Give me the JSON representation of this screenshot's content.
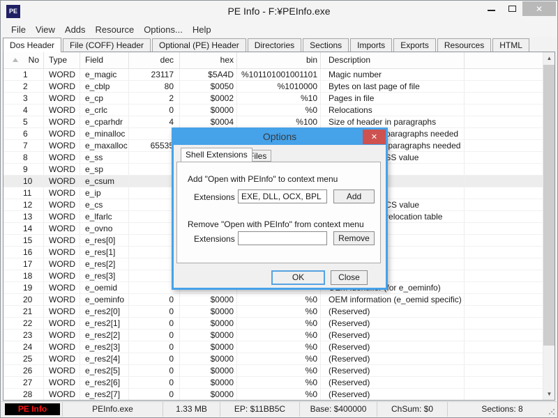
{
  "window": {
    "icon_text": "PE",
    "title": "PE Info - F:¥PEInfo.exe"
  },
  "icons": {
    "close_window": "✕",
    "close_dialog": "✕",
    "scroll_up": "▲",
    "scroll_down": "▼"
  },
  "menu": [
    "File",
    "View",
    "Adds",
    "Resource",
    "Options...",
    "Help"
  ],
  "tabs": {
    "items": [
      "Dos Header",
      "File (COFF) Header",
      "Optional (PE) Header",
      "Directories",
      "Sections",
      "Imports",
      "Exports",
      "Resources",
      "HTML"
    ],
    "selected": "Dos Header"
  },
  "table": {
    "columns": [
      "No",
      "Type",
      "Field",
      "dec",
      "hex",
      "bin",
      "Description"
    ],
    "hot_row_no": "10",
    "rows": [
      [
        "1",
        "WORD",
        "e_magic",
        "23117",
        "$5A4D",
        "%101101001001101",
        "Magic number"
      ],
      [
        "2",
        "WORD",
        "e_cblp",
        "80",
        "$0050",
        "%1010000",
        "Bytes on last page of file"
      ],
      [
        "3",
        "WORD",
        "e_cp",
        "2",
        "$0002",
        "%10",
        "Pages in file"
      ],
      [
        "4",
        "WORD",
        "e_crlc",
        "0",
        "$0000",
        "%0",
        "Relocations"
      ],
      [
        "5",
        "WORD",
        "e_cparhdr",
        "4",
        "$0004",
        "%100",
        "Size of header in paragraphs"
      ],
      [
        "6",
        "WORD",
        "e_minalloc",
        "",
        "",
        "",
        "Minimum extra paragraphs needed"
      ],
      [
        "7",
        "WORD",
        "e_maxalloc",
        "65535",
        "",
        "",
        "Maximum extra paragraphs needed"
      ],
      [
        "8",
        "WORD",
        "e_ss",
        "",
        "",
        "",
        "Initial (relative) SS value"
      ],
      [
        "9",
        "WORD",
        "e_sp",
        "",
        "",
        "",
        ""
      ],
      [
        "10",
        "WORD",
        "e_csum",
        "",
        "",
        "",
        ""
      ],
      [
        "11",
        "WORD",
        "e_ip",
        "",
        "",
        "",
        ""
      ],
      [
        "12",
        "WORD",
        "e_cs",
        "",
        "",
        "",
        "Initial (relative) CS value"
      ],
      [
        "13",
        "WORD",
        "e_lfarlc",
        "",
        "",
        "",
        "File address of relocation table"
      ],
      [
        "14",
        "WORD",
        "e_ovno",
        "",
        "",
        "",
        ""
      ],
      [
        "15",
        "WORD",
        "e_res[0]",
        "",
        "",
        "",
        ""
      ],
      [
        "16",
        "WORD",
        "e_res[1]",
        "",
        "",
        "",
        ""
      ],
      [
        "17",
        "WORD",
        "e_res[2]",
        "",
        "",
        "",
        ""
      ],
      [
        "18",
        "WORD",
        "e_res[3]",
        "",
        "",
        "",
        ""
      ],
      [
        "19",
        "WORD",
        "e_oemid",
        "",
        "",
        "",
        "OEM identifier (for e_oeminfo)"
      ],
      [
        "20",
        "WORD",
        "e_oeminfo",
        "0",
        "$0000",
        "%0",
        "OEM information (e_oemid specific)"
      ],
      [
        "21",
        "WORD",
        "e_res2[0]",
        "0",
        "$0000",
        "%0",
        "(Reserved)"
      ],
      [
        "22",
        "WORD",
        "e_res2[1]",
        "0",
        "$0000",
        "%0",
        "(Reserved)"
      ],
      [
        "23",
        "WORD",
        "e_res2[2]",
        "0",
        "$0000",
        "%0",
        "(Reserved)"
      ],
      [
        "24",
        "WORD",
        "e_res2[3]",
        "0",
        "$0000",
        "%0",
        "(Reserved)"
      ],
      [
        "25",
        "WORD",
        "e_res2[4]",
        "0",
        "$0000",
        "%0",
        "(Reserved)"
      ],
      [
        "26",
        "WORD",
        "e_res2[5]",
        "0",
        "$0000",
        "%0",
        "(Reserved)"
      ],
      [
        "27",
        "WORD",
        "e_res2[6]",
        "0",
        "$0000",
        "%0",
        "(Reserved)"
      ],
      [
        "28",
        "WORD",
        "e_res2[7]",
        "0",
        "$0000",
        "%0",
        "(Reserved)"
      ]
    ]
  },
  "dialog": {
    "title": "Options",
    "tabs": {
      "items": [
        "Shell Extensions",
        "Files"
      ],
      "selected": "Shell Extensions"
    },
    "add_section": {
      "heading": "Add \"Open with PEInfo\" to context menu",
      "extensions_label": "Extensions :",
      "input_value": "EXE, DLL, OCX, BPL",
      "button_label": "Add"
    },
    "remove_section": {
      "heading": "Remove \"Open with PEInfo\" from context menu",
      "extensions_label": "Extensions :",
      "input_value": "",
      "button_label": "Remove"
    },
    "ok_label": "OK",
    "close_label": "Close"
  },
  "status_bar": {
    "logo": "PE Info",
    "panels": [
      "PEInfo.exe",
      "1.33 MB",
      "EP: $11BB5C",
      "Base: $400000",
      "ChSum: $0",
      "Sections: 8"
    ]
  },
  "colors": {
    "dialog_accent": "#46a2e9",
    "dialog_close_red": "#cd5250",
    "status_logo_red": "#ff1212",
    "icon_bg_navy": "#1f2064"
  }
}
